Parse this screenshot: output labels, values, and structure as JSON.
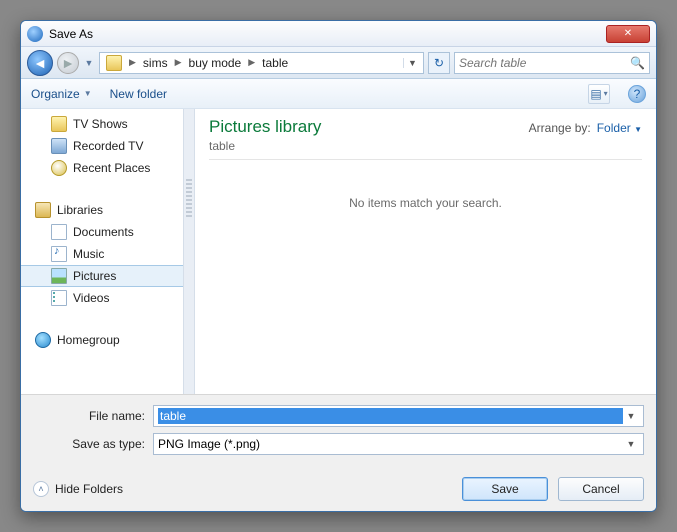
{
  "window": {
    "title": "Save As"
  },
  "nav": {
    "breadcrumbs": [
      "sims",
      "buy mode",
      "table"
    ],
    "search_placeholder": "Search table"
  },
  "toolbar": {
    "organize": "Organize",
    "new_folder": "New folder"
  },
  "sidebar": {
    "items": [
      {
        "label": "TV Shows"
      },
      {
        "label": "Recorded TV"
      },
      {
        "label": "Recent Places"
      }
    ],
    "libraries_label": "Libraries",
    "libraries": [
      {
        "label": "Documents"
      },
      {
        "label": "Music"
      },
      {
        "label": "Pictures",
        "selected": true
      },
      {
        "label": "Videos"
      }
    ],
    "homegroup_label": "Homegroup"
  },
  "main": {
    "library_title": "Pictures library",
    "library_sub": "table",
    "arrange_label": "Arrange by:",
    "arrange_value": "Folder",
    "empty_text": "No items match your search."
  },
  "form": {
    "filename_label": "File name:",
    "filename_value": "table",
    "type_label": "Save as type:",
    "type_value": "PNG Image (*.png)"
  },
  "footer": {
    "hide_folders": "Hide Folders",
    "save": "Save",
    "cancel": "Cancel"
  }
}
